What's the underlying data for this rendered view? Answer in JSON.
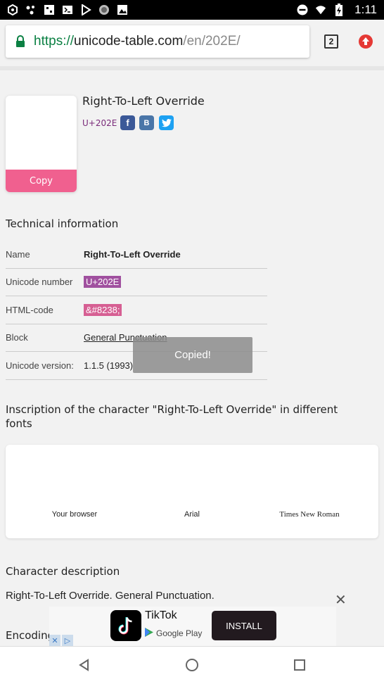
{
  "status_bar": {
    "time": "1:11",
    "icons": [
      "hexagon-icon",
      "dots-icon",
      "photo-grid-icon",
      "terminal-icon",
      "play-store-icon",
      "circle-icon",
      "image-icon",
      "dnd-icon",
      "wifi-icon",
      "battery-icon"
    ]
  },
  "browser": {
    "url_scheme": "https://",
    "url_host": "unicode-table.com",
    "url_path": "/en/202E/",
    "tab_count": "2"
  },
  "character": {
    "title": "Right-To-Left Override",
    "code": "U+202E",
    "copy_label": "Copy",
    "social": {
      "facebook": "f",
      "vk": "B",
      "twitter": "twitter-icon"
    }
  },
  "technical": {
    "heading": "Technical information",
    "rows": [
      {
        "key": "Name",
        "value": "Right-To-Left Override"
      },
      {
        "key": "Unicode number",
        "value": "U+202E"
      },
      {
        "key": "HTML-code",
        "value": "&#8238;"
      },
      {
        "key": "Block",
        "value": "General Punctuation"
      },
      {
        "key": "Unicode version:",
        "value": "1.1.5 (1993)"
      }
    ]
  },
  "toast": "Copied!",
  "inscription": {
    "heading_line1": "Inscription of the character \"Right-To-Left Override\" in different",
    "heading_line2": "fonts",
    "fonts": [
      "Your browser",
      "Arial",
      "Times New Roman"
    ]
  },
  "description": {
    "heading": "Character description",
    "text": "Right-To-Left Override. General Punctuation."
  },
  "encoding_heading": "Encoding",
  "ad": {
    "title": "TikTok",
    "store": "Google Play",
    "install": "INSTALL"
  },
  "colors": {
    "copy_button": "#f0608f",
    "code_tag": "#a0509f",
    "html_tag": "#d65f93"
  }
}
